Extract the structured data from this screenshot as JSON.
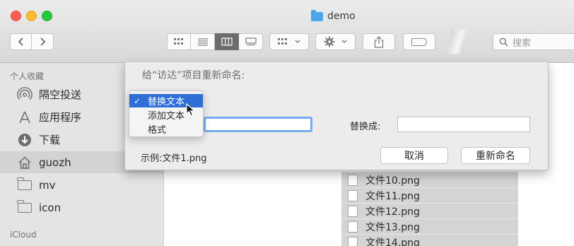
{
  "window": {
    "title": "demo"
  },
  "toolbar": {
    "back_icon": "chevron-left",
    "forward_icon": "chevron-right",
    "views": [
      "icon-view",
      "list-view",
      "column-view",
      "gallery-view"
    ],
    "active_view": "column-view",
    "search_placeholder": "搜索"
  },
  "sidebar": {
    "favorites_header": "个人收藏",
    "items": [
      {
        "label": "隔空投送",
        "icon": "airdrop-icon"
      },
      {
        "label": "应用程序",
        "icon": "applications-icon"
      },
      {
        "label": "下载",
        "icon": "download-icon"
      },
      {
        "label": "guozh",
        "icon": "home-icon",
        "selected": true
      },
      {
        "label": "mv",
        "icon": "folder-icon"
      },
      {
        "label": "icon",
        "icon": "folder-icon"
      }
    ],
    "icloud_header": "iCloud"
  },
  "files": [
    "文件10.png",
    "文件11.png",
    "文件12.png",
    "文件13.png",
    "文件14.png"
  ],
  "rename_sheet": {
    "title": "给“访达”项目重新命名:",
    "replace_with_label": "替换成:",
    "example": "示例:文件1.png",
    "cancel_label": "取消",
    "rename_label": "重新命名"
  },
  "rename_menu": {
    "items": [
      "替换文本",
      "添加文本",
      "格式"
    ],
    "selected": "替换文本"
  }
}
